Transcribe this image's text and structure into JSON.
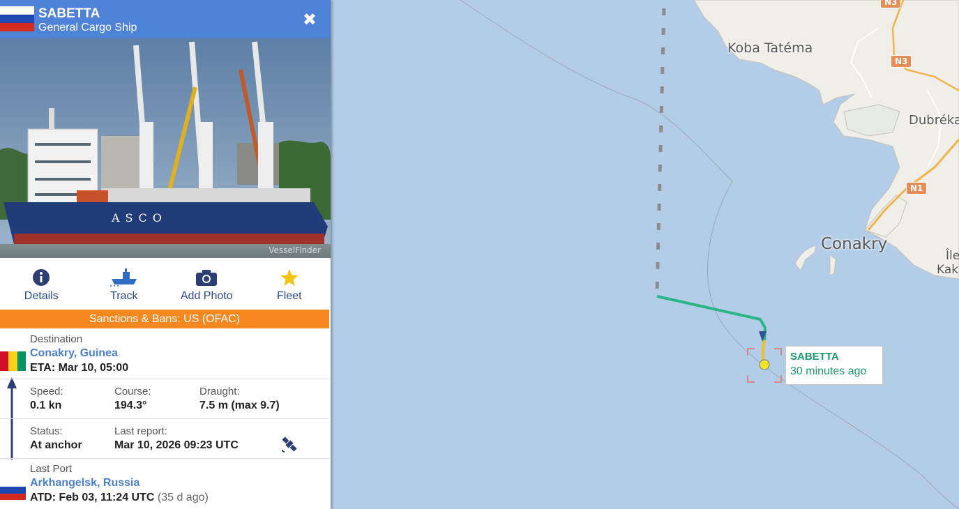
{
  "vessel": {
    "name": "SABETTA",
    "type": "General Cargo Ship",
    "close_icon": "close-icon",
    "photo_watermark": "VesselFinder",
    "hull_text": "ASCO"
  },
  "actions": [
    {
      "label": "Details",
      "icon": "info-icon"
    },
    {
      "label": "Track",
      "icon": "ship-track-icon"
    },
    {
      "label": "Add Photo",
      "icon": "camera-icon"
    },
    {
      "label": "Fleet",
      "icon": "star-icon"
    }
  ],
  "sanctions": "Sanctions & Bans: US (OFAC)",
  "destination": {
    "caption": "Destination",
    "port": "Conakry, Guinea",
    "eta": "ETA: Mar 10, 05:00"
  },
  "stats": {
    "speed_caption": "Speed:",
    "speed": "0.1 kn",
    "course_caption": "Course:",
    "course": "194.3°",
    "draught_caption": "Draught:",
    "draught": "7.5 m (max 9.7)"
  },
  "status": {
    "status_caption": "Status:",
    "status": "At anchor",
    "report_caption": "Last report:",
    "report": "Mar 10, 2026 09:23 UTC",
    "icon": "satellite-icon"
  },
  "last_port": {
    "caption": "Last Port",
    "port": "Arkhangelsk, Russia",
    "atd": "ATD: Feb 03, 11:24 UTC",
    "ago": "(35 d ago)"
  },
  "map": {
    "places": [
      "Koba Tatéma",
      "Dubréka",
      "Conakry",
      "Île",
      "Kak"
    ],
    "shields": [
      "N3",
      "N3",
      "N1"
    ],
    "vessel_label": "SABETTA",
    "vessel_ago": "30 minutes ago",
    "colors": {
      "sea": "#b3cde8",
      "land": "#f0eee9",
      "track": "#2bb585",
      "shield": "#e58c57"
    }
  }
}
